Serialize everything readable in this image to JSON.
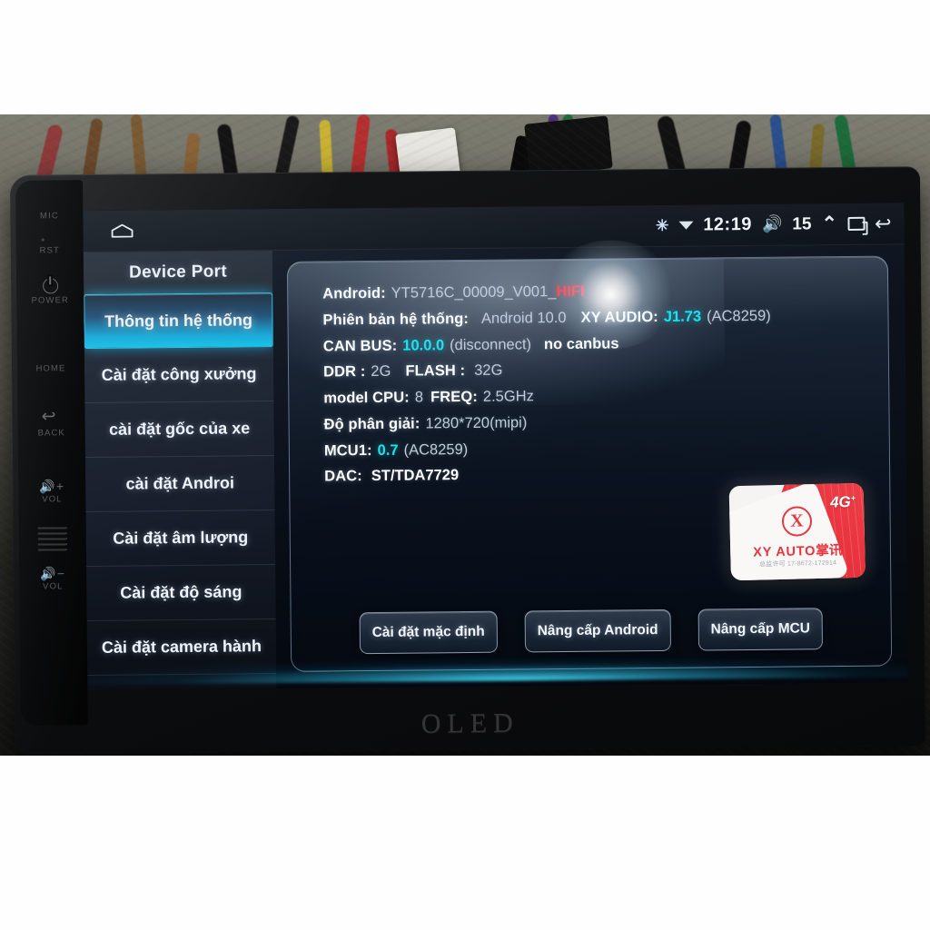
{
  "device": {
    "brand_label": "OLED",
    "hardkeys": [
      {
        "label": "MIC",
        "icon": "microphone-icon"
      },
      {
        "label": "RST",
        "icon": "reset-pinhole-icon"
      },
      {
        "label": "POWER",
        "icon": "power-icon"
      },
      {
        "label": "HOME",
        "icon": "home-grid-icon"
      },
      {
        "label": "BACK",
        "icon": "back-arrow-icon"
      },
      {
        "label": "VOL",
        "icon": "volume-up-icon"
      },
      {
        "label": "VOL",
        "icon": "volume-down-icon"
      }
    ]
  },
  "statusbar": {
    "home_icon": "home-house-icon",
    "bluetooth_icon": "bluetooth-icon",
    "signal_icon": "signal-triangle-icon",
    "time": "12:19",
    "volume_icon": "speaker-icon",
    "volume_level": "15",
    "expand_icon": "chevron-up-icon",
    "recents_icon": "recent-apps-icon",
    "back_icon": "back-arrow-icon"
  },
  "sidebar": {
    "title": "Device Port",
    "items": [
      {
        "label": "Thông tin hệ thống",
        "selected": true
      },
      {
        "label": "Cài đặt công xưởng",
        "selected": false
      },
      {
        "label": "cài đặt gốc của xe",
        "selected": false
      },
      {
        "label": "cài đặt Androi",
        "selected": false
      },
      {
        "label": "Cài đặt âm lượng",
        "selected": false
      },
      {
        "label": "Cài đặt độ sáng",
        "selected": false
      },
      {
        "label": "Cài đặt camera hành",
        "selected": false
      }
    ]
  },
  "info": {
    "rows": [
      {
        "label": "Android:",
        "value": "YT5716C_00009_V001_",
        "extra": "HIFI",
        "extra_style": "red"
      },
      {
        "label": "Phiên bản hệ thống:",
        "value": "Android 10.0",
        "label2": "XY AUDIO:",
        "value2": "J1.73",
        "value2_style": "cyan",
        "suffix2": "(AC8259)"
      },
      {
        "label": "CAN BUS:",
        "value": "10.0.0",
        "value_style": "cyan",
        "suffix": "(disconnect)",
        "extra": "no canbus",
        "extra_style": "white-bold"
      },
      {
        "label": "DDR :",
        "value": "2G",
        "label2": "FLASH :",
        "value2": "32G"
      },
      {
        "label": "model CPU:",
        "value": "8",
        "label2": "FREQ:",
        "value2": "2.5GHz"
      },
      {
        "label": "Độ phân giải:",
        "value": "1280*720(mipi)"
      },
      {
        "label": "MCU1:",
        "value": "0.7",
        "value_style": "cyan",
        "suffix": "(AC8259)"
      },
      {
        "label": "DAC:",
        "value": "ST/TDA7729",
        "value_style": "white-bold"
      }
    ]
  },
  "logo_card": {
    "mark": "X",
    "brand": "XY AUTO",
    "brand_cn": "掌讯",
    "badge": "4G",
    "fine_print": "总监许可 17-8672-172914"
  },
  "actions": {
    "buttons": [
      {
        "label": "Cài đặt mặc định"
      },
      {
        "label": "Nâng cấp Android"
      },
      {
        "label": "Nâng cấp MCU"
      }
    ]
  },
  "colors": {
    "accent_cyan": "#19e3f0",
    "alert_red": "#ff3a4a",
    "selected_gradient_end": "#12c3e8",
    "brand_red": "#e8343e"
  }
}
